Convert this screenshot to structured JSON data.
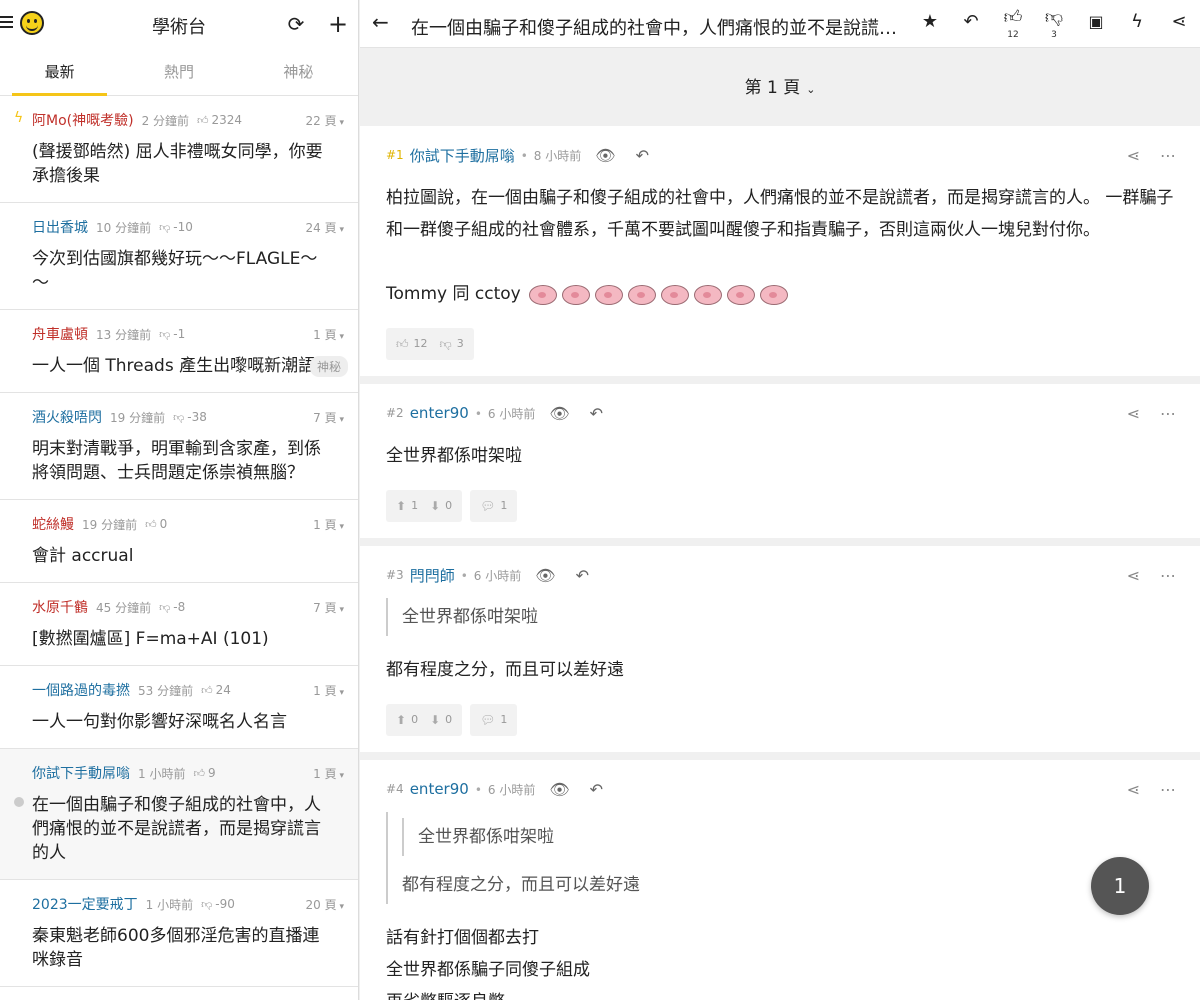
{
  "board": {
    "title": "學術台"
  },
  "tabs": [
    {
      "label": "最新"
    },
    {
      "label": "熱門"
    },
    {
      "label": "神秘"
    }
  ],
  "topics": [
    {
      "author": "阿Mo(神嘅考驗)",
      "gender": "f",
      "time": "2 分鐘前",
      "vote_icon": "thumbs-up",
      "vote": "2324",
      "pages": "22 頁",
      "title": "(聲援鄧皓然) 屈人非禮嘅女同學，你要承擔後果",
      "hot": true
    },
    {
      "author": "日出香城",
      "gender": "m",
      "time": "10 分鐘前",
      "vote_icon": "thumbs-down",
      "vote": "-10",
      "pages": "24 頁",
      "title": "今次到估國旗都幾好玩～～FLAGLE～～"
    },
    {
      "author": "舟車盧頓",
      "gender": "f",
      "time": "13 分鐘前",
      "vote_icon": "thumbs-down",
      "vote": "-1",
      "pages": "1 頁",
      "title": "一人一個 Threads 產生出嚟嘅新潮語",
      "tag": "神秘"
    },
    {
      "author": "酒火殺唔閃",
      "gender": "m",
      "time": "19 分鐘前",
      "vote_icon": "thumbs-down",
      "vote": "-38",
      "pages": "7 頁",
      "title": "明末對清戰爭，明軍輸到含家產，到係將領問題、士兵問題定係崇禎無腦？"
    },
    {
      "author": "蛇絲鰻",
      "gender": "f",
      "time": "19 分鐘前",
      "vote_icon": "thumbs-up",
      "vote": "0",
      "pages": "1 頁",
      "title": "會計 accrual"
    },
    {
      "author": "水原千鶴",
      "gender": "f",
      "time": "45 分鐘前",
      "vote_icon": "thumbs-down",
      "vote": "-8",
      "pages": "7 頁",
      "title": "[數撚圍爐區] F=ma+AI (101)"
    },
    {
      "author": "一個路過的毒撚",
      "gender": "m",
      "time": "53 分鐘前",
      "vote_icon": "thumbs-up",
      "vote": "24",
      "pages": "1 頁",
      "title": "一人一句對你影響好深嘅名人名言"
    },
    {
      "author": "你試下手動屌嗡",
      "gender": "m",
      "time": "1 小時前",
      "vote_icon": "thumbs-up",
      "vote": "9",
      "pages": "1 頁",
      "title": "在一個由騙子和傻子組成的社會中，人們痛恨的並不是說謊者，而是揭穿謊言的人",
      "current": true
    },
    {
      "author": "2023一定要戒丁",
      "gender": "m",
      "time": "1 小時前",
      "vote_icon": "thumbs-down",
      "vote": "-90",
      "pages": "20 頁",
      "title": "秦東魁老師600多個邪淫危害的直播連咪錄音"
    }
  ],
  "thread": {
    "title": "在一個由騙子和傻子組成的社會中，人們痛恨的並不是說謊者，而是揭穿謊言的人",
    "likes": "12",
    "dislikes": "3",
    "page_label": "第 1 頁"
  },
  "posts": [
    {
      "no": "#1",
      "author": "你試下手動屌嗡",
      "time": "8 小時前",
      "body": [
        "柏拉圖說，在一個由騙子和傻子組成的社會中，人們痛恨的並不是說謊者，而是揭穿謊言的人。 一群騙子和一群傻子組成的社會體系，千萬不要試圖叫醒傻子和指責騙子，否則這兩伙人一塊兒對付你。",
        "",
        "Tommy 同 cctoy"
      ],
      "emoji_count": 8,
      "likes": "12",
      "dislikes": "3"
    },
    {
      "no": "#2",
      "author": "enter90",
      "time": "6 小時前",
      "body": [
        "全世界都係咁架啦"
      ],
      "up": "1",
      "down": "0",
      "replies": "1"
    },
    {
      "no": "#3",
      "author": "閂閂師",
      "time": "6 小時前",
      "quote": "全世界都係咁架啦",
      "body": [
        "都有程度之分，而且可以差好遠"
      ],
      "up": "0",
      "down": "0",
      "replies": "1"
    },
    {
      "no": "#4",
      "author": "enter90",
      "time": "6 小時前",
      "nested_quote": "全世界都係咁架啦",
      "quote": "都有程度之分，而且可以差好遠",
      "body": [
        "話有針打個個都去打",
        "全世界都係騙子同傻子組成",
        "再劣幣驅逐良幣"
      ]
    }
  ],
  "fab": {
    "page": "1"
  },
  "colors": {
    "accent": "#f5c518",
    "male": "#1e6fa0",
    "female": "#c0302a"
  }
}
